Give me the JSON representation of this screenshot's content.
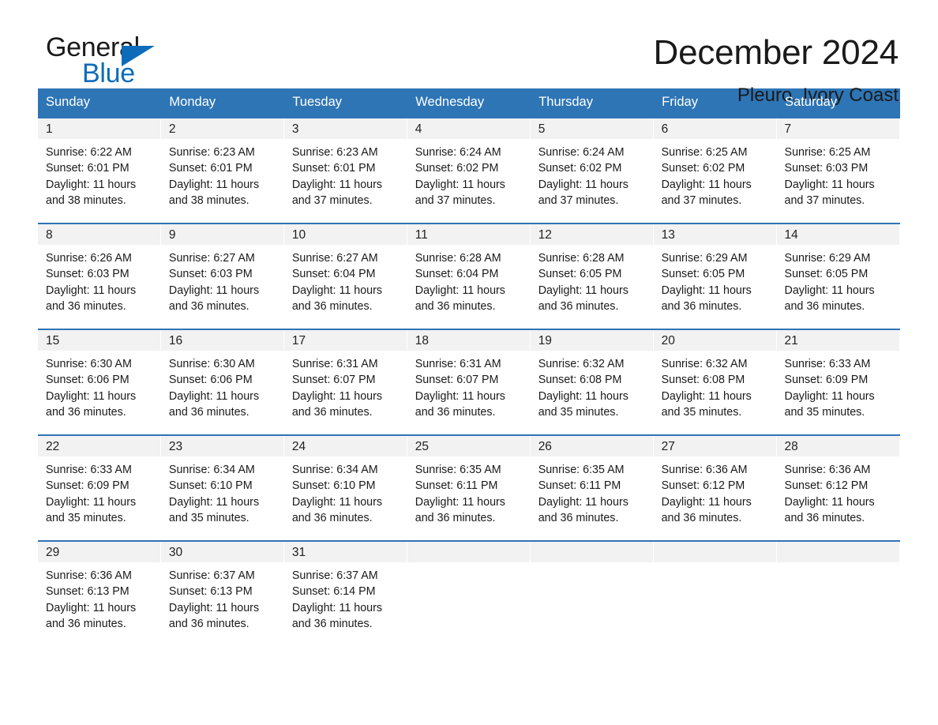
{
  "brand": {
    "name_top": "General",
    "name_bottom": "Blue",
    "triangle_icon": "triangle-icon",
    "accent_color": "#0d6cb9"
  },
  "header": {
    "title": "December 2024",
    "subtitle": "Pleuro, Ivory Coast"
  },
  "theme": {
    "header_blue": "#2e75b6",
    "band_gray": "#f2f2f2",
    "text_dark": "#1a1a1a"
  },
  "calendar": {
    "day_names": [
      "Sunday",
      "Monday",
      "Tuesday",
      "Wednesday",
      "Thursday",
      "Friday",
      "Saturday"
    ],
    "labels": {
      "sunrise": "Sunrise:",
      "sunset": "Sunset:",
      "daylight": "Daylight:"
    },
    "weeks": [
      [
        {
          "day": "1",
          "sunrise": "Sunrise: 6:22 AM",
          "sunset": "Sunset: 6:01 PM",
          "daylight_1": "Daylight: 11 hours",
          "daylight_2": "and 38 minutes."
        },
        {
          "day": "2",
          "sunrise": "Sunrise: 6:23 AM",
          "sunset": "Sunset: 6:01 PM",
          "daylight_1": "Daylight: 11 hours",
          "daylight_2": "and 38 minutes."
        },
        {
          "day": "3",
          "sunrise": "Sunrise: 6:23 AM",
          "sunset": "Sunset: 6:01 PM",
          "daylight_1": "Daylight: 11 hours",
          "daylight_2": "and 37 minutes."
        },
        {
          "day": "4",
          "sunrise": "Sunrise: 6:24 AM",
          "sunset": "Sunset: 6:02 PM",
          "daylight_1": "Daylight: 11 hours",
          "daylight_2": "and 37 minutes."
        },
        {
          "day": "5",
          "sunrise": "Sunrise: 6:24 AM",
          "sunset": "Sunset: 6:02 PM",
          "daylight_1": "Daylight: 11 hours",
          "daylight_2": "and 37 minutes."
        },
        {
          "day": "6",
          "sunrise": "Sunrise: 6:25 AM",
          "sunset": "Sunset: 6:02 PM",
          "daylight_1": "Daylight: 11 hours",
          "daylight_2": "and 37 minutes."
        },
        {
          "day": "7",
          "sunrise": "Sunrise: 6:25 AM",
          "sunset": "Sunset: 6:03 PM",
          "daylight_1": "Daylight: 11 hours",
          "daylight_2": "and 37 minutes."
        }
      ],
      [
        {
          "day": "8",
          "sunrise": "Sunrise: 6:26 AM",
          "sunset": "Sunset: 6:03 PM",
          "daylight_1": "Daylight: 11 hours",
          "daylight_2": "and 36 minutes."
        },
        {
          "day": "9",
          "sunrise": "Sunrise: 6:27 AM",
          "sunset": "Sunset: 6:03 PM",
          "daylight_1": "Daylight: 11 hours",
          "daylight_2": "and 36 minutes."
        },
        {
          "day": "10",
          "sunrise": "Sunrise: 6:27 AM",
          "sunset": "Sunset: 6:04 PM",
          "daylight_1": "Daylight: 11 hours",
          "daylight_2": "and 36 minutes."
        },
        {
          "day": "11",
          "sunrise": "Sunrise: 6:28 AM",
          "sunset": "Sunset: 6:04 PM",
          "daylight_1": "Daylight: 11 hours",
          "daylight_2": "and 36 minutes."
        },
        {
          "day": "12",
          "sunrise": "Sunrise: 6:28 AM",
          "sunset": "Sunset: 6:05 PM",
          "daylight_1": "Daylight: 11 hours",
          "daylight_2": "and 36 minutes."
        },
        {
          "day": "13",
          "sunrise": "Sunrise: 6:29 AM",
          "sunset": "Sunset: 6:05 PM",
          "daylight_1": "Daylight: 11 hours",
          "daylight_2": "and 36 minutes."
        },
        {
          "day": "14",
          "sunrise": "Sunrise: 6:29 AM",
          "sunset": "Sunset: 6:05 PM",
          "daylight_1": "Daylight: 11 hours",
          "daylight_2": "and 36 minutes."
        }
      ],
      [
        {
          "day": "15",
          "sunrise": "Sunrise: 6:30 AM",
          "sunset": "Sunset: 6:06 PM",
          "daylight_1": "Daylight: 11 hours",
          "daylight_2": "and 36 minutes."
        },
        {
          "day": "16",
          "sunrise": "Sunrise: 6:30 AM",
          "sunset": "Sunset: 6:06 PM",
          "daylight_1": "Daylight: 11 hours",
          "daylight_2": "and 36 minutes."
        },
        {
          "day": "17",
          "sunrise": "Sunrise: 6:31 AM",
          "sunset": "Sunset: 6:07 PM",
          "daylight_1": "Daylight: 11 hours",
          "daylight_2": "and 36 minutes."
        },
        {
          "day": "18",
          "sunrise": "Sunrise: 6:31 AM",
          "sunset": "Sunset: 6:07 PM",
          "daylight_1": "Daylight: 11 hours",
          "daylight_2": "and 36 minutes."
        },
        {
          "day": "19",
          "sunrise": "Sunrise: 6:32 AM",
          "sunset": "Sunset: 6:08 PM",
          "daylight_1": "Daylight: 11 hours",
          "daylight_2": "and 35 minutes."
        },
        {
          "day": "20",
          "sunrise": "Sunrise: 6:32 AM",
          "sunset": "Sunset: 6:08 PM",
          "daylight_1": "Daylight: 11 hours",
          "daylight_2": "and 35 minutes."
        },
        {
          "day": "21",
          "sunrise": "Sunrise: 6:33 AM",
          "sunset": "Sunset: 6:09 PM",
          "daylight_1": "Daylight: 11 hours",
          "daylight_2": "and 35 minutes."
        }
      ],
      [
        {
          "day": "22",
          "sunrise": "Sunrise: 6:33 AM",
          "sunset": "Sunset: 6:09 PM",
          "daylight_1": "Daylight: 11 hours",
          "daylight_2": "and 35 minutes."
        },
        {
          "day": "23",
          "sunrise": "Sunrise: 6:34 AM",
          "sunset": "Sunset: 6:10 PM",
          "daylight_1": "Daylight: 11 hours",
          "daylight_2": "and 35 minutes."
        },
        {
          "day": "24",
          "sunrise": "Sunrise: 6:34 AM",
          "sunset": "Sunset: 6:10 PM",
          "daylight_1": "Daylight: 11 hours",
          "daylight_2": "and 36 minutes."
        },
        {
          "day": "25",
          "sunrise": "Sunrise: 6:35 AM",
          "sunset": "Sunset: 6:11 PM",
          "daylight_1": "Daylight: 11 hours",
          "daylight_2": "and 36 minutes."
        },
        {
          "day": "26",
          "sunrise": "Sunrise: 6:35 AM",
          "sunset": "Sunset: 6:11 PM",
          "daylight_1": "Daylight: 11 hours",
          "daylight_2": "and 36 minutes."
        },
        {
          "day": "27",
          "sunrise": "Sunrise: 6:36 AM",
          "sunset": "Sunset: 6:12 PM",
          "daylight_1": "Daylight: 11 hours",
          "daylight_2": "and 36 minutes."
        },
        {
          "day": "28",
          "sunrise": "Sunrise: 6:36 AM",
          "sunset": "Sunset: 6:12 PM",
          "daylight_1": "Daylight: 11 hours",
          "daylight_2": "and 36 minutes."
        }
      ],
      [
        {
          "day": "29",
          "sunrise": "Sunrise: 6:36 AM",
          "sunset": "Sunset: 6:13 PM",
          "daylight_1": "Daylight: 11 hours",
          "daylight_2": "and 36 minutes."
        },
        {
          "day": "30",
          "sunrise": "Sunrise: 6:37 AM",
          "sunset": "Sunset: 6:13 PM",
          "daylight_1": "Daylight: 11 hours",
          "daylight_2": "and 36 minutes."
        },
        {
          "day": "31",
          "sunrise": "Sunrise: 6:37 AM",
          "sunset": "Sunset: 6:14 PM",
          "daylight_1": "Daylight: 11 hours",
          "daylight_2": "and 36 minutes."
        },
        {
          "day": "",
          "sunrise": "",
          "sunset": "",
          "daylight_1": "",
          "daylight_2": ""
        },
        {
          "day": "",
          "sunrise": "",
          "sunset": "",
          "daylight_1": "",
          "daylight_2": ""
        },
        {
          "day": "",
          "sunrise": "",
          "sunset": "",
          "daylight_1": "",
          "daylight_2": ""
        },
        {
          "day": "",
          "sunrise": "",
          "sunset": "",
          "daylight_1": "",
          "daylight_2": ""
        }
      ]
    ]
  }
}
